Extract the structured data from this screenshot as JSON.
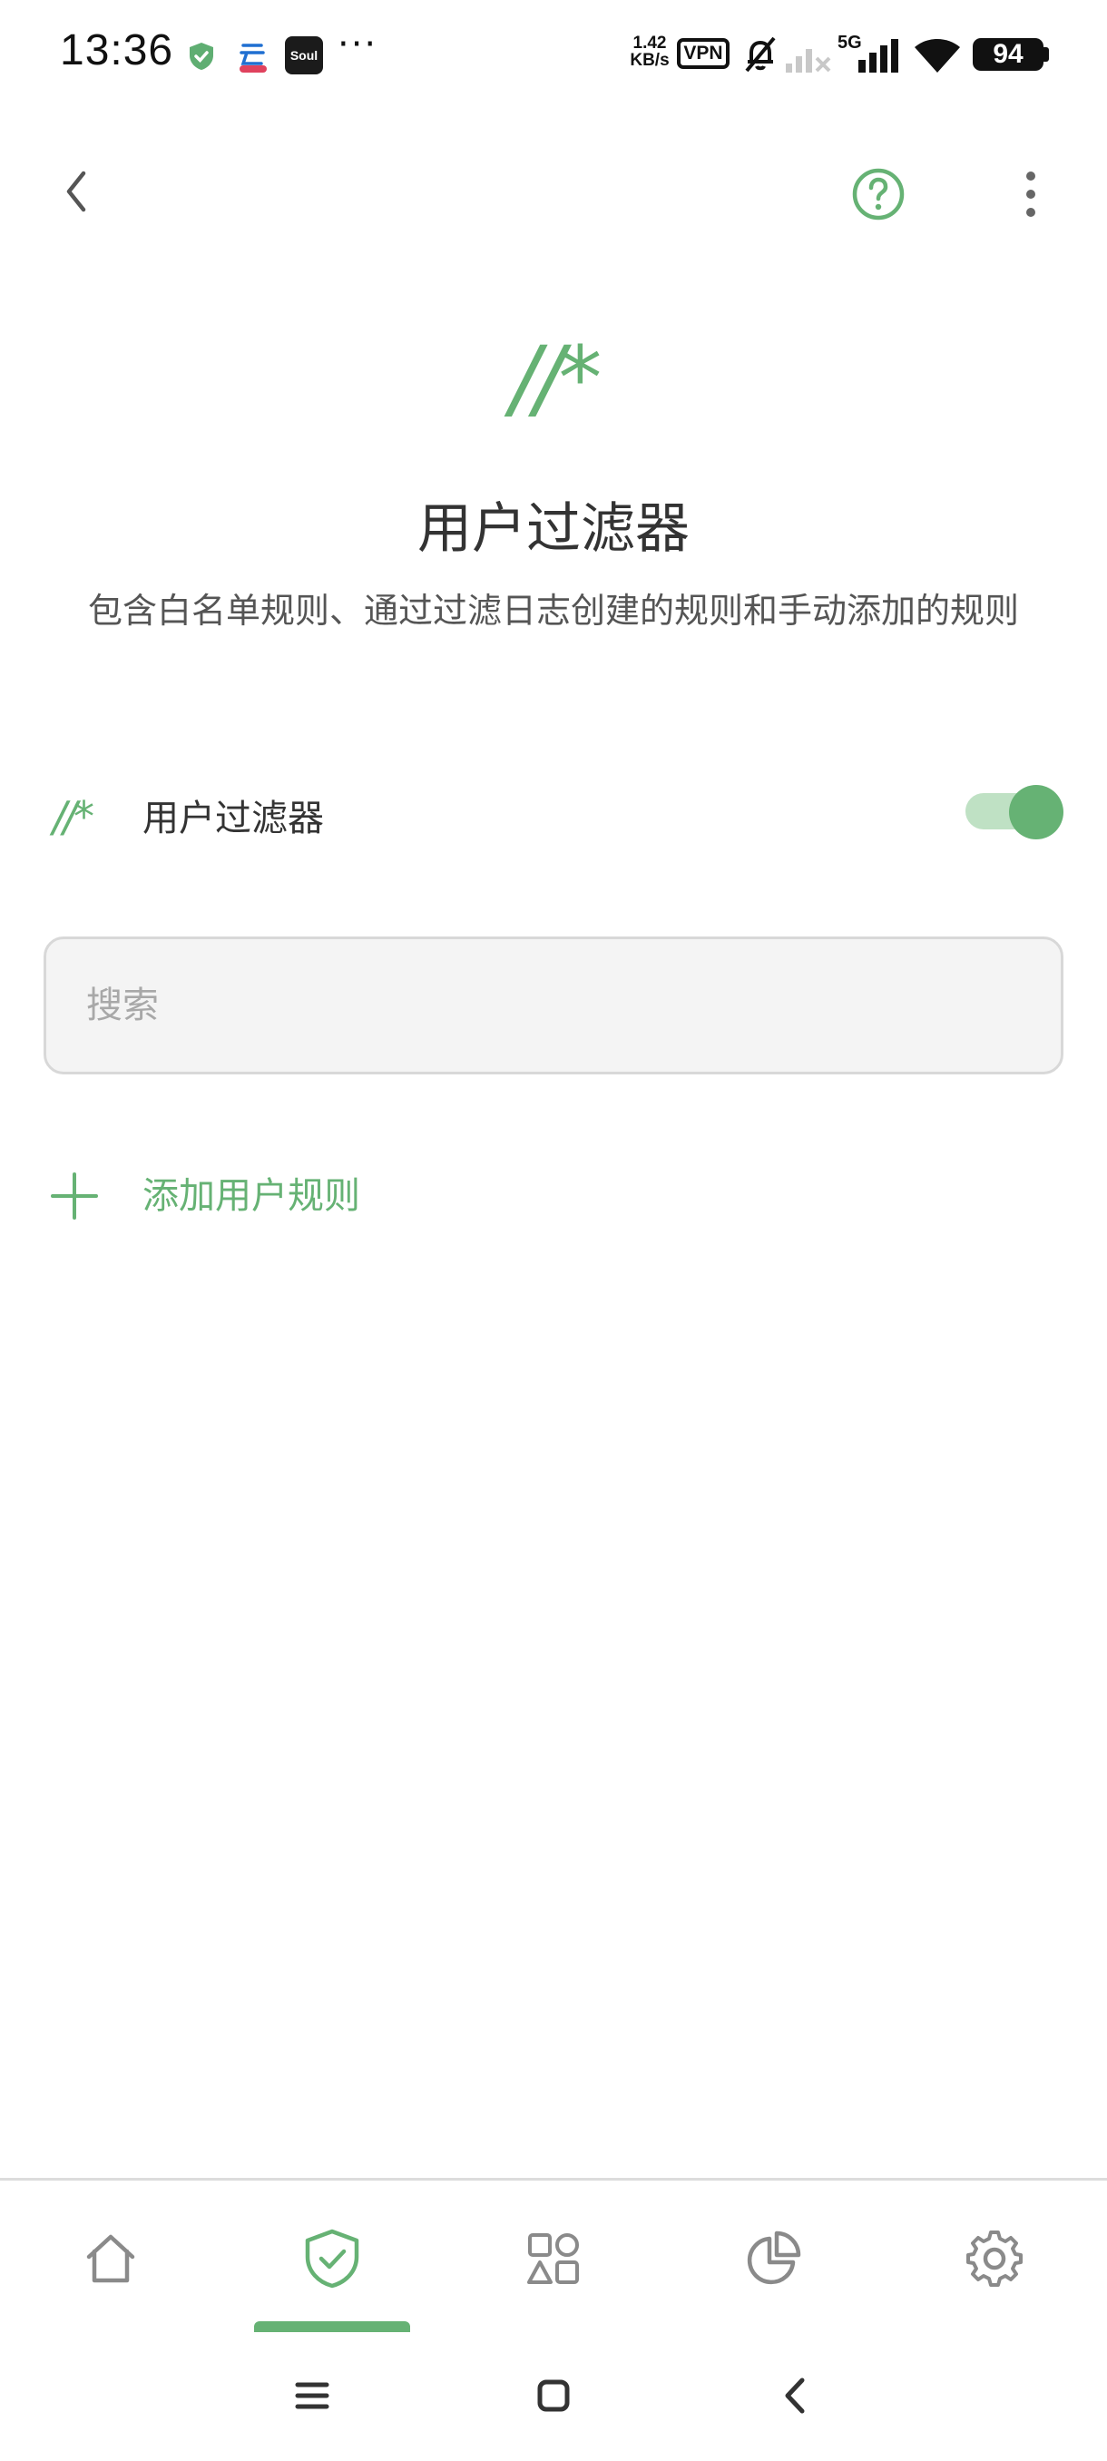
{
  "status_bar": {
    "time": "13:36",
    "net_speed_value": "1.42",
    "net_speed_unit": "KB/s",
    "vpn": "VPN",
    "network": "5G",
    "battery": "94",
    "more": "···",
    "notification_icons": [
      "shield-check-icon",
      "cloud-app-icon",
      "soul-app-icon"
    ],
    "right_icons": [
      "mute-bell-icon",
      "signal-weak-icon",
      "signal-icon",
      "wifi-icon",
      "battery-icon"
    ]
  },
  "toolbar": {
    "back_icon": "chevron-left-icon",
    "help_icon": "help-circle-icon",
    "menu_icon": "more-vertical-icon"
  },
  "header": {
    "logo_text": "//*",
    "title": "用户过滤器",
    "description": "包含白名单规则、通过过滤日志创建的规则和手动添加的规则"
  },
  "filter_row": {
    "logo_text": "//*",
    "label": "用户过滤器",
    "enabled": true
  },
  "search": {
    "placeholder": "搜索",
    "value": ""
  },
  "add_rule": {
    "icon": "plus-icon",
    "label": "添加用户规则"
  },
  "bottom_nav": {
    "items": [
      {
        "icon": "home-icon",
        "active": false
      },
      {
        "icon": "shield-check-icon",
        "active": true
      },
      {
        "icon": "apps-icon",
        "active": false
      },
      {
        "icon": "pie-chart-icon",
        "active": false
      },
      {
        "icon": "gear-icon",
        "active": false
      }
    ]
  },
  "system_nav": {
    "items": [
      "menu-icon",
      "home-square-icon",
      "back-icon"
    ]
  },
  "colors": {
    "accent": "#66b274",
    "accent_light": "#bfe1c4",
    "text_primary": "#333333",
    "text_secondary": "#555555",
    "icon_gray": "#8a8a8a"
  }
}
